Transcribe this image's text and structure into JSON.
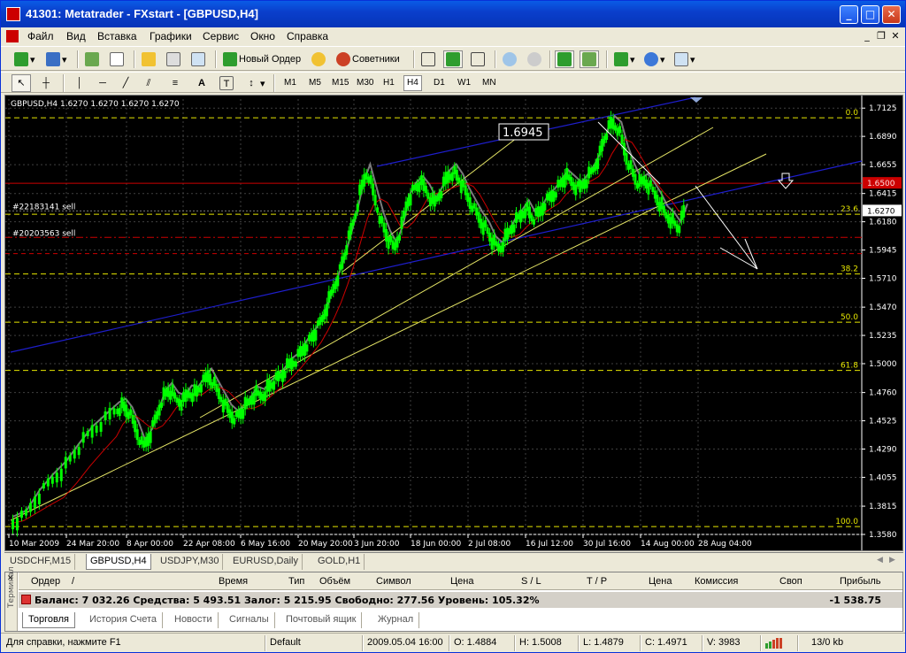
{
  "window": {
    "title": "41301: Metatrader - FXstart - [GBPUSD,H4]",
    "minimize": "_",
    "maximize": "□",
    "close": "✕"
  },
  "menu": {
    "items": [
      "Файл",
      "Вид",
      "Вставка",
      "Графики",
      "Сервис",
      "Окно",
      "Справка"
    ]
  },
  "toolbar": {
    "new_order_label": "Новый Ордер",
    "experts_label": "Советники"
  },
  "timeframes": [
    "M1",
    "M5",
    "M15",
    "M30",
    "H1",
    "H4",
    "D1",
    "W1",
    "MN"
  ],
  "active_timeframe": "H4",
  "chart": {
    "info": "GBPUSD,H4  1.6270 1.6270 1.6270 1.6270",
    "price_box": "1.6945",
    "order1": "#22183141 sell",
    "order2": "#20203563 sell",
    "current_price": "1.6270",
    "red_level_label": "1.6500",
    "fib_labels": [
      "0.0",
      "23.6",
      "38.2",
      "50.0",
      "61.8",
      "100.0"
    ],
    "colors": {
      "background": "#000000",
      "candle": "#00ff00",
      "ghost": "#9a9a9a",
      "grid": "#404040",
      "fib": "#e6e600",
      "trend_yellow": "#e6e666",
      "channel_blue": "#1e1ecc",
      "ma_red": "#cc0000",
      "level_red": "#cc0000",
      "projection": "#ffffff",
      "label": "#ffffff"
    }
  },
  "chart_data": {
    "type": "candlestick",
    "symbol": "GBPUSD",
    "timeframe": "H4",
    "y_ticks": [
      "1.7125",
      "1.6890",
      "1.6655",
      "1.6415",
      "1.6180",
      "1.5945",
      "1.5710",
      "1.5470",
      "1.5235",
      "1.5000",
      "1.4760",
      "1.4525",
      "1.4290",
      "1.4055",
      "1.3815",
      "1.3580"
    ],
    "x_ticks": [
      "10 Mar 2009",
      "24 Mar 20:00",
      "8 Apr 00:00",
      "22 Apr 08:00",
      "6 May 16:00",
      "20 May 20:00",
      "3 Jun 20:00",
      "18 Jun 00:00",
      "2 Jul 08:00",
      "16 Jul 12:00",
      "30 Jul 16:00",
      "14 Aug 00:00",
      "28 Aug 04:00"
    ],
    "ylim": [
      1.358,
      1.72
    ],
    "close_path": [
      [
        0,
        1.367
      ],
      [
        2,
        1.372
      ],
      [
        4,
        1.389
      ],
      [
        6,
        1.402
      ],
      [
        8,
        1.413
      ],
      [
        10,
        1.428
      ],
      [
        12,
        1.442
      ],
      [
        14,
        1.452
      ],
      [
        16,
        1.462
      ],
      [
        17,
        1.465
      ],
      [
        18,
        1.458
      ],
      [
        19,
        1.445
      ],
      [
        20,
        1.43
      ],
      [
        21,
        1.44
      ],
      [
        22,
        1.455
      ],
      [
        23,
        1.472
      ],
      [
        24,
        1.478
      ],
      [
        25,
        1.47
      ],
      [
        26,
        1.468
      ],
      [
        27,
        1.476
      ],
      [
        28,
        1.475
      ],
      [
        29,
        1.483
      ],
      [
        30,
        1.49
      ],
      [
        31,
        1.48
      ],
      [
        32,
        1.47
      ],
      [
        33,
        1.46
      ],
      [
        34,
        1.455
      ],
      [
        35,
        1.46
      ],
      [
        36,
        1.467
      ],
      [
        37,
        1.475
      ],
      [
        38,
        1.473
      ],
      [
        39,
        1.48
      ],
      [
        40,
        1.485
      ],
      [
        41,
        1.49
      ],
      [
        42,
        1.498
      ],
      [
        43,
        1.502
      ],
      [
        44,
        1.51
      ],
      [
        45,
        1.518
      ],
      [
        46,
        1.525
      ],
      [
        47,
        1.535
      ],
      [
        48,
        1.55
      ],
      [
        49,
        1.565
      ],
      [
        50,
        1.58
      ],
      [
        51,
        1.6
      ],
      [
        52,
        1.62
      ],
      [
        53,
        1.645
      ],
      [
        54,
        1.66
      ],
      [
        55,
        1.64
      ],
      [
        56,
        1.62
      ],
      [
        57,
        1.605
      ],
      [
        58,
        1.595
      ],
      [
        59,
        1.61
      ],
      [
        60,
        1.635
      ],
      [
        61,
        1.645
      ],
      [
        62,
        1.65
      ],
      [
        63,
        1.643
      ],
      [
        64,
        1.632
      ],
      [
        65,
        1.642
      ],
      [
        66,
        1.655
      ],
      [
        67,
        1.66
      ],
      [
        68,
        1.652
      ],
      [
        69,
        1.64
      ],
      [
        70,
        1.63
      ],
      [
        71,
        1.62
      ],
      [
        72,
        1.612
      ],
      [
        73,
        1.6
      ],
      [
        74,
        1.595
      ],
      [
        75,
        1.605
      ],
      [
        76,
        1.615
      ],
      [
        77,
        1.622
      ],
      [
        78,
        1.63
      ],
      [
        79,
        1.62
      ],
      [
        80,
        1.625
      ],
      [
        81,
        1.635
      ],
      [
        82,
        1.64
      ],
      [
        83,
        1.648
      ],
      [
        84,
        1.655
      ],
      [
        85,
        1.65
      ],
      [
        86,
        1.645
      ],
      [
        87,
        1.652
      ],
      [
        88,
        1.66
      ],
      [
        89,
        1.672
      ],
      [
        90,
        1.69
      ],
      [
        91,
        1.7
      ],
      [
        92,
        1.695
      ],
      [
        93,
        1.675
      ],
      [
        94,
        1.66
      ],
      [
        95,
        1.648
      ],
      [
        96,
        1.652
      ],
      [
        97,
        1.645
      ],
      [
        98,
        1.636
      ],
      [
        99,
        1.625
      ],
      [
        100,
        1.62
      ],
      [
        101,
        1.612
      ],
      [
        102,
        1.627
      ]
    ]
  },
  "chart_tabs": [
    "USDCHF,M15",
    "GBPUSD,H4",
    "USDJPY,M30",
    "EURUSD,Daily",
    "GOLD,H1"
  ],
  "active_chart_tab": "GBPUSD,H4",
  "terminal": {
    "side_label": "Терминал",
    "headers": [
      "Ордер",
      "/",
      "Время",
      "Тип",
      "Объём",
      "Символ",
      "Цена",
      "S / L",
      "T / P",
      "Цена",
      "Комиссия",
      "Своп",
      "Прибыль"
    ],
    "balance_line": "Баланс: 7 032.26  Средства: 5 493.51  Залог: 5 215.95  Свободно: 277.56  Уровень: 105.32%",
    "total_profit": "-1 538.75",
    "tabs": [
      "Торговля",
      "История Счета",
      "Новости",
      "Сигналы",
      "Почтовый ящик",
      "Журнал"
    ],
    "active_tab": "Торговля"
  },
  "statusbar": {
    "help": "Для справки, нажмите F1",
    "profile": "Default",
    "datetime": "2009.05.04 16:00",
    "open": "O: 1.4884",
    "high": "H: 1.5008",
    "low": "L: 1.4879",
    "close": "C: 1.4971",
    "volume": "V: 3983",
    "traffic": "13/0 kb"
  }
}
